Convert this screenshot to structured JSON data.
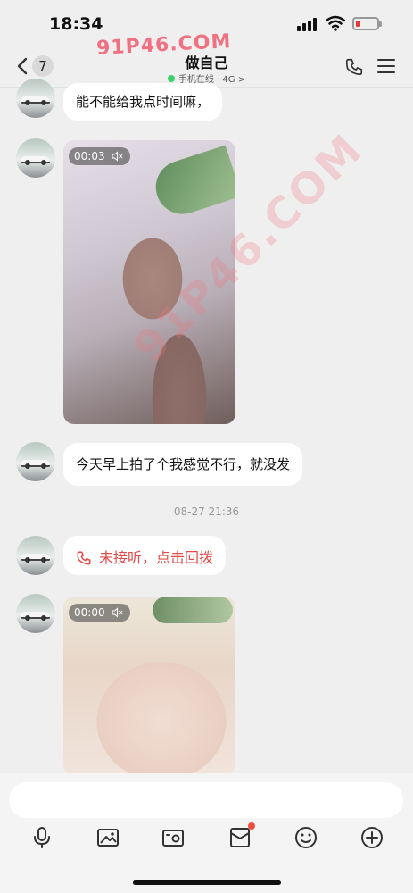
{
  "status_bar": {
    "time": "18:34",
    "battery_color": "#e23a3a"
  },
  "nav": {
    "back_count": "7",
    "title": "做自己",
    "subtitle": "手机在线 · 4G >",
    "online_color": "#3ccf6a"
  },
  "watermark": {
    "top": "91P46.COM",
    "diagonal": "91P46.COM"
  },
  "messages": [
    {
      "type": "text",
      "text": "能不能给我点时间嘛，"
    },
    {
      "type": "video",
      "duration": "00:03"
    },
    {
      "type": "text",
      "text": "今天早上拍了个我感觉不行，就没发"
    },
    {
      "type": "timestamp",
      "text": "08-27 21:36"
    },
    {
      "type": "missed_call",
      "text": "未接听，点击回拨",
      "color": "#e24a4a"
    },
    {
      "type": "video",
      "duration": "00:00"
    }
  ],
  "input": {
    "value": "",
    "placeholder": ""
  },
  "toolbar": {
    "icons": [
      "microphone-icon",
      "image-icon",
      "camera-icon",
      "redpacket-icon",
      "emoji-icon",
      "plus-icon"
    ],
    "notification_dot_color": "#f04d3a"
  }
}
